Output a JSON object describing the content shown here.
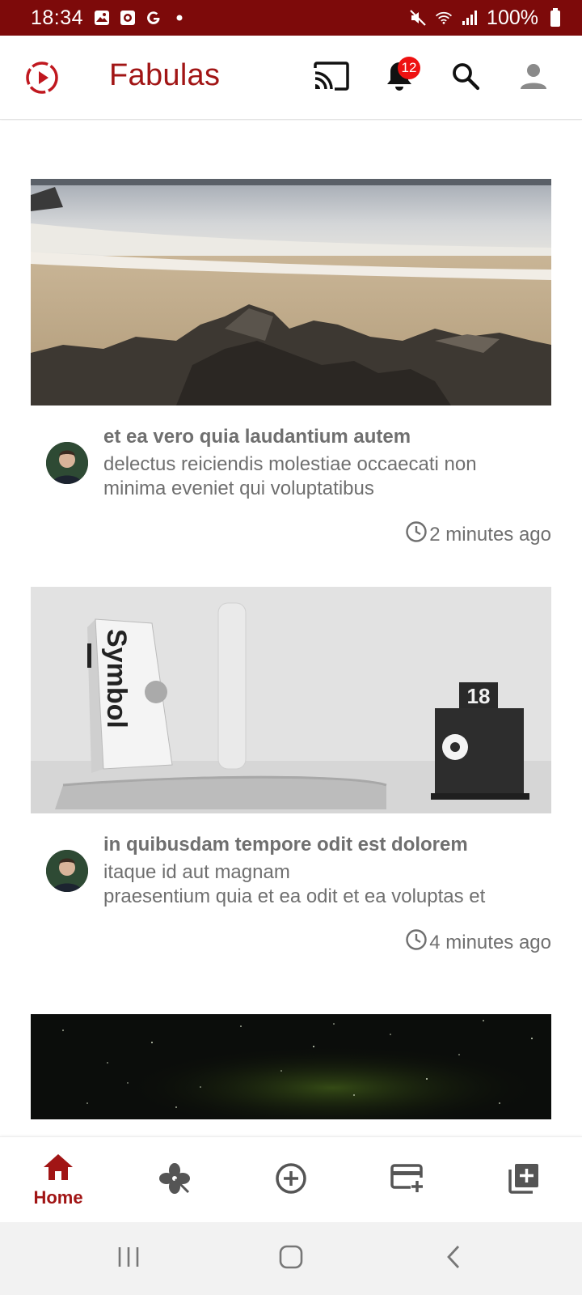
{
  "status_bar": {
    "time": "18:34",
    "battery_text": "100%",
    "left_icons": [
      "gallery-icon",
      "screen-record-icon",
      "google-icon",
      "dot-icon"
    ],
    "right_icons": [
      "mute-icon",
      "wifi-icon",
      "signal-icon",
      "battery-icon"
    ]
  },
  "app_bar": {
    "title": "Fabulas",
    "logo_icon": "play-circle-icon",
    "notification_count": "12",
    "actions": [
      "cast-icon",
      "bell-icon",
      "search-icon",
      "account-icon"
    ]
  },
  "colors": {
    "brand": "#a11515",
    "status_bar": "#7d0a0a",
    "text_secondary": "#6f6f6f",
    "badge": "#ee1111"
  },
  "posts": [
    {
      "image": "beach-rocks-photo",
      "title": "et ea vero quia laudantium autem",
      "body": "delectus reiciendis molestiae occaecati non minima eveniet qui voluptatibus",
      "time": "2 minutes ago"
    },
    {
      "image": "desk-book-laptop-photo",
      "title": "in quibusdam tempore odit est dolorem",
      "body": "itaque id aut magnam\npraesentium quia et ea odit et ea voluptas et",
      "time": "4 minutes ago",
      "image_book_text": "Symbol",
      "image_calendar_text": "18"
    },
    {
      "image": "night-sky-photo"
    }
  ],
  "bottom_nav": {
    "items": [
      {
        "icon": "home-icon",
        "label": "Home",
        "active": true
      },
      {
        "icon": "clover-icon",
        "label": ""
      },
      {
        "icon": "add-circle-icon",
        "label": ""
      },
      {
        "icon": "card-add-icon",
        "label": ""
      },
      {
        "icon": "library-add-icon",
        "label": ""
      }
    ]
  },
  "system_nav": [
    "recents-icon",
    "home-button-icon",
    "back-icon"
  ]
}
